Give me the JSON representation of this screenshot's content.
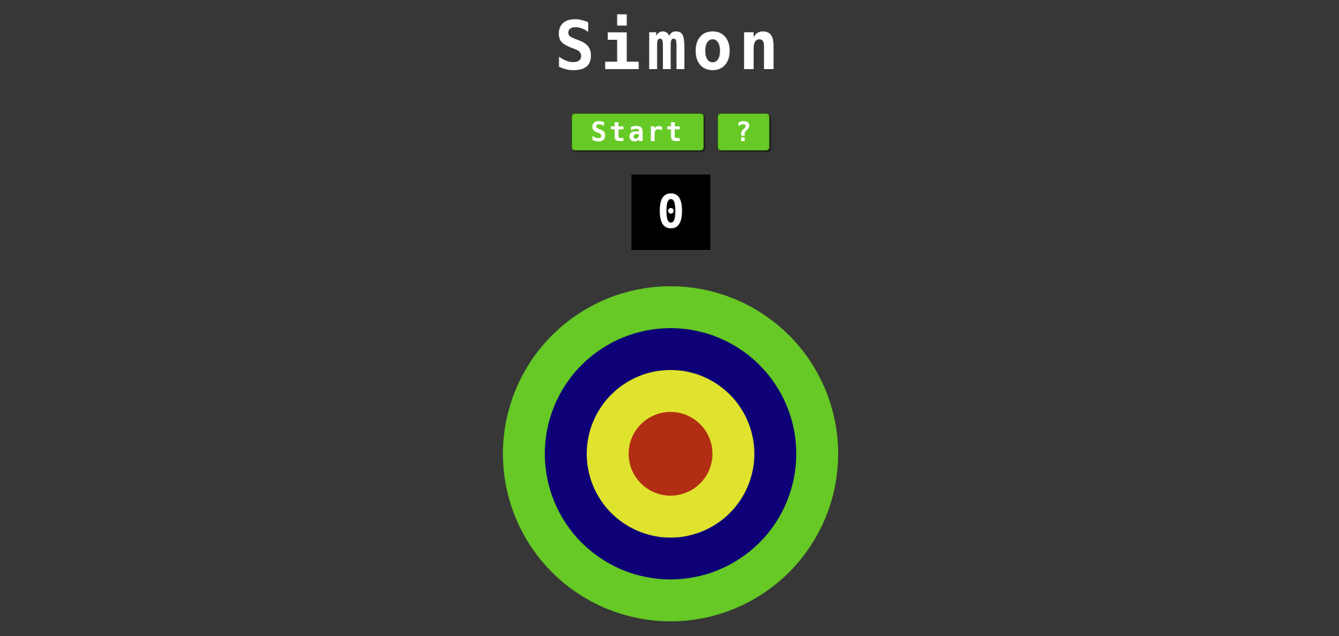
{
  "title": "Simon",
  "controls": {
    "start_label": "Start",
    "help_label": "?"
  },
  "score": "0",
  "colors": {
    "background": "#373737",
    "button": "#66c925",
    "score_background": "#000000",
    "outer_ring": "#66c925",
    "second_ring": "#0e0077",
    "third_ring": "#dfe32e",
    "center": "#b12d13"
  }
}
